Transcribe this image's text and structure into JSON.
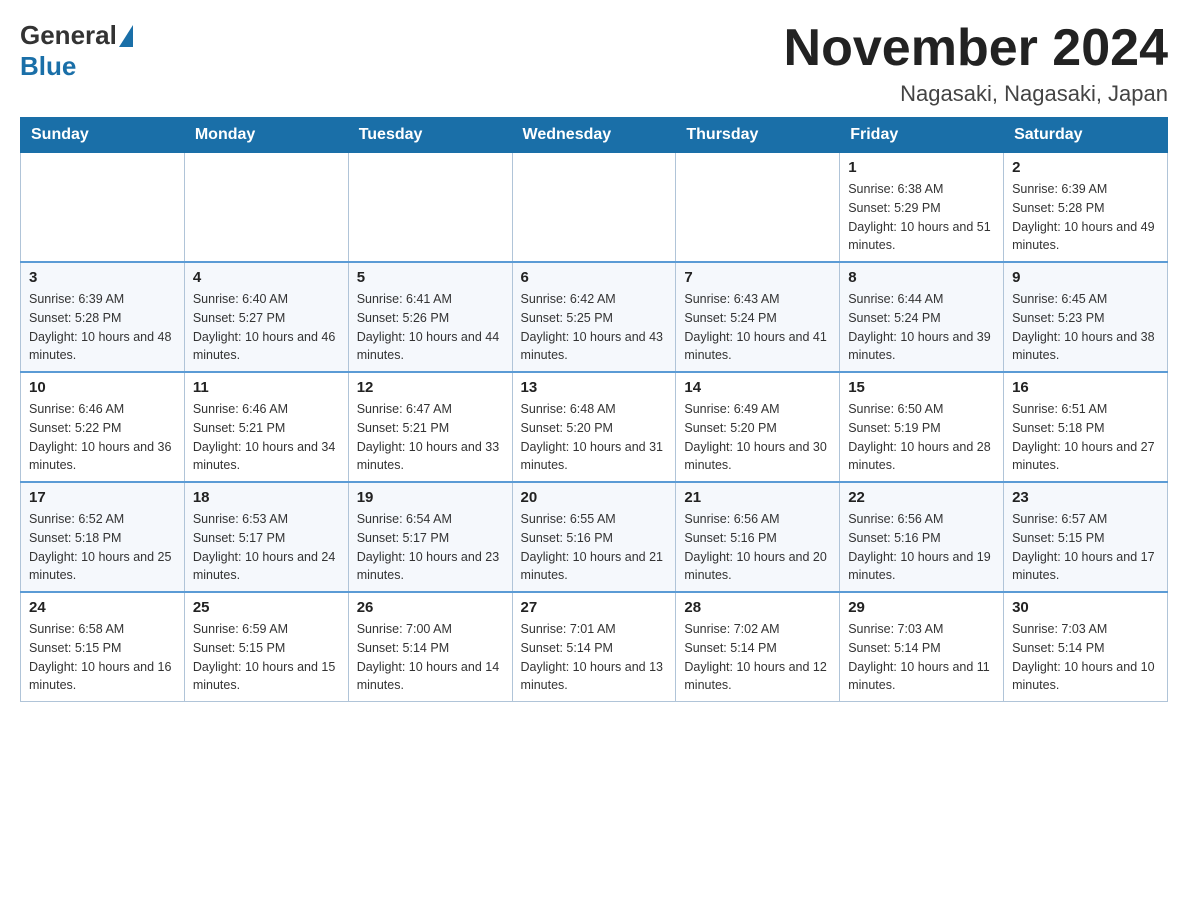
{
  "header": {
    "logo_general": "General",
    "logo_blue": "Blue",
    "month_title": "November 2024",
    "location": "Nagasaki, Nagasaki, Japan"
  },
  "days_of_week": [
    "Sunday",
    "Monday",
    "Tuesday",
    "Wednesday",
    "Thursday",
    "Friday",
    "Saturday"
  ],
  "weeks": [
    [
      {
        "day": "",
        "info": ""
      },
      {
        "day": "",
        "info": ""
      },
      {
        "day": "",
        "info": ""
      },
      {
        "day": "",
        "info": ""
      },
      {
        "day": "",
        "info": ""
      },
      {
        "day": "1",
        "info": "Sunrise: 6:38 AM\nSunset: 5:29 PM\nDaylight: 10 hours and 51 minutes."
      },
      {
        "day": "2",
        "info": "Sunrise: 6:39 AM\nSunset: 5:28 PM\nDaylight: 10 hours and 49 minutes."
      }
    ],
    [
      {
        "day": "3",
        "info": "Sunrise: 6:39 AM\nSunset: 5:28 PM\nDaylight: 10 hours and 48 minutes."
      },
      {
        "day": "4",
        "info": "Sunrise: 6:40 AM\nSunset: 5:27 PM\nDaylight: 10 hours and 46 minutes."
      },
      {
        "day": "5",
        "info": "Sunrise: 6:41 AM\nSunset: 5:26 PM\nDaylight: 10 hours and 44 minutes."
      },
      {
        "day": "6",
        "info": "Sunrise: 6:42 AM\nSunset: 5:25 PM\nDaylight: 10 hours and 43 minutes."
      },
      {
        "day": "7",
        "info": "Sunrise: 6:43 AM\nSunset: 5:24 PM\nDaylight: 10 hours and 41 minutes."
      },
      {
        "day": "8",
        "info": "Sunrise: 6:44 AM\nSunset: 5:24 PM\nDaylight: 10 hours and 39 minutes."
      },
      {
        "day": "9",
        "info": "Sunrise: 6:45 AM\nSunset: 5:23 PM\nDaylight: 10 hours and 38 minutes."
      }
    ],
    [
      {
        "day": "10",
        "info": "Sunrise: 6:46 AM\nSunset: 5:22 PM\nDaylight: 10 hours and 36 minutes."
      },
      {
        "day": "11",
        "info": "Sunrise: 6:46 AM\nSunset: 5:21 PM\nDaylight: 10 hours and 34 minutes."
      },
      {
        "day": "12",
        "info": "Sunrise: 6:47 AM\nSunset: 5:21 PM\nDaylight: 10 hours and 33 minutes."
      },
      {
        "day": "13",
        "info": "Sunrise: 6:48 AM\nSunset: 5:20 PM\nDaylight: 10 hours and 31 minutes."
      },
      {
        "day": "14",
        "info": "Sunrise: 6:49 AM\nSunset: 5:20 PM\nDaylight: 10 hours and 30 minutes."
      },
      {
        "day": "15",
        "info": "Sunrise: 6:50 AM\nSunset: 5:19 PM\nDaylight: 10 hours and 28 minutes."
      },
      {
        "day": "16",
        "info": "Sunrise: 6:51 AM\nSunset: 5:18 PM\nDaylight: 10 hours and 27 minutes."
      }
    ],
    [
      {
        "day": "17",
        "info": "Sunrise: 6:52 AM\nSunset: 5:18 PM\nDaylight: 10 hours and 25 minutes."
      },
      {
        "day": "18",
        "info": "Sunrise: 6:53 AM\nSunset: 5:17 PM\nDaylight: 10 hours and 24 minutes."
      },
      {
        "day": "19",
        "info": "Sunrise: 6:54 AM\nSunset: 5:17 PM\nDaylight: 10 hours and 23 minutes."
      },
      {
        "day": "20",
        "info": "Sunrise: 6:55 AM\nSunset: 5:16 PM\nDaylight: 10 hours and 21 minutes."
      },
      {
        "day": "21",
        "info": "Sunrise: 6:56 AM\nSunset: 5:16 PM\nDaylight: 10 hours and 20 minutes."
      },
      {
        "day": "22",
        "info": "Sunrise: 6:56 AM\nSunset: 5:16 PM\nDaylight: 10 hours and 19 minutes."
      },
      {
        "day": "23",
        "info": "Sunrise: 6:57 AM\nSunset: 5:15 PM\nDaylight: 10 hours and 17 minutes."
      }
    ],
    [
      {
        "day": "24",
        "info": "Sunrise: 6:58 AM\nSunset: 5:15 PM\nDaylight: 10 hours and 16 minutes."
      },
      {
        "day": "25",
        "info": "Sunrise: 6:59 AM\nSunset: 5:15 PM\nDaylight: 10 hours and 15 minutes."
      },
      {
        "day": "26",
        "info": "Sunrise: 7:00 AM\nSunset: 5:14 PM\nDaylight: 10 hours and 14 minutes."
      },
      {
        "day": "27",
        "info": "Sunrise: 7:01 AM\nSunset: 5:14 PM\nDaylight: 10 hours and 13 minutes."
      },
      {
        "day": "28",
        "info": "Sunrise: 7:02 AM\nSunset: 5:14 PM\nDaylight: 10 hours and 12 minutes."
      },
      {
        "day": "29",
        "info": "Sunrise: 7:03 AM\nSunset: 5:14 PM\nDaylight: 10 hours and 11 minutes."
      },
      {
        "day": "30",
        "info": "Sunrise: 7:03 AM\nSunset: 5:14 PM\nDaylight: 10 hours and 10 minutes."
      }
    ]
  ]
}
